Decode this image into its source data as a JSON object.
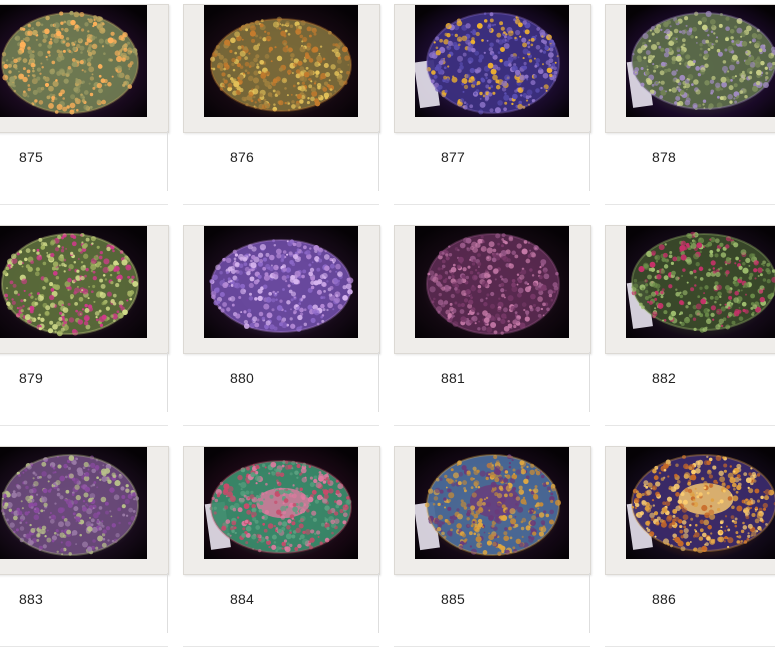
{
  "gallery": {
    "items": [
      {
        "label": "875",
        "palette": {
          "bg": "#1a0a1f",
          "a": "#6f7a52",
          "b": "#9a9a62",
          "c": "#c4a860",
          "d": "#ffb15a"
        }
      },
      {
        "label": "876",
        "palette": {
          "bg": "#140810",
          "a": "#7a6a3a",
          "b": "#a3823f",
          "c": "#c47b2d",
          "d": "#e6c45a"
        }
      },
      {
        "label": "877",
        "palette": {
          "bg": "#1a0b2c",
          "a": "#3c2f7f",
          "b": "#5b4fb2",
          "c": "#8d73c8",
          "d": "#f0b230"
        }
      },
      {
        "label": "878",
        "palette": {
          "bg": "#1b0a2a",
          "a": "#5b6a4a",
          "b": "#7a8a5a",
          "c": "#a08cc0",
          "d": "#c8d088"
        }
      },
      {
        "label": "879",
        "palette": {
          "bg": "#120812",
          "a": "#5a6a3a",
          "b": "#a0b060",
          "c": "#d2dc8a",
          "d": "#d03a8a"
        }
      },
      {
        "label": "880",
        "palette": {
          "bg": "#160a18",
          "a": "#6a4aa0",
          "b": "#8c68c8",
          "c": "#b489d6",
          "d": "#d8b6f0"
        }
      },
      {
        "label": "881",
        "palette": {
          "bg": "#120810",
          "a": "#5a2a50",
          "b": "#7a3a6a",
          "c": "#9a5a8a",
          "d": "#c67aa8"
        }
      },
      {
        "label": "882",
        "palette": {
          "bg": "#140a18",
          "a": "#3a4a2a",
          "b": "#6c8c4a",
          "c": "#a0c070",
          "d": "#c8326a"
        }
      },
      {
        "label": "883",
        "palette": {
          "bg": "#170b1a",
          "a": "#6a4a7a",
          "b": "#9a7aa6",
          "c": "#b8c08a",
          "d": "#8a4aa0"
        }
      },
      {
        "label": "884",
        "palette": {
          "bg": "#1a0814",
          "a": "#3a8a6a",
          "b": "#5aa080",
          "c": "#c84a6a",
          "d": "#e07aa0"
        }
      },
      {
        "label": "885",
        "palette": {
          "bg": "#140816",
          "a": "#4a6a9a",
          "b": "#c28a3a",
          "c": "#e0a840",
          "d": "#6a3a7a"
        }
      },
      {
        "label": "886",
        "palette": {
          "bg": "#120a1a",
          "a": "#3a2a6a",
          "b": "#c86a28",
          "c": "#e0a040",
          "d": "#ffd070"
        }
      }
    ]
  }
}
